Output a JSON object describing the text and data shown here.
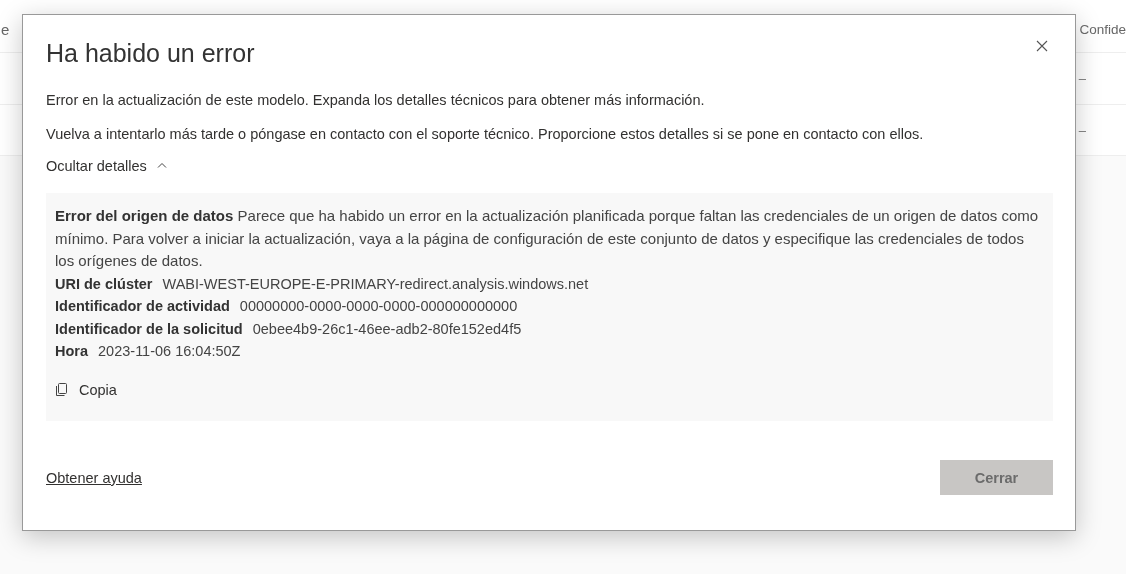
{
  "background": {
    "header": [
      "e",
      "Confide"
    ],
    "rows": [
      {
        "cell": "–"
      },
      {
        "cell": "–"
      }
    ]
  },
  "dialog": {
    "title": "Ha habido un error",
    "messages": [
      "Error en la actualización de este modelo. Expanda los detalles técnicos para obtener más información.",
      "Vuelva a intentarlo más tarde o póngase en contacto con el soporte técnico. Proporcione estos detalles si se pone en contacto con ellos."
    ],
    "details_toggle": {
      "label": "Ocultar detalles",
      "expanded": true
    },
    "details": {
      "summary": "**Error del origen de datos**  Parece que ha habido un error en la actualización planificada porque faltan las credenciales de un origen de datos como mínimo. Para volver a iniciar la actualización, vaya a la página de configuración de este conjunto de datos y especifique las credenciales de todos los orígenes de datos.",
      "fields": [
        {
          "label": "URI de clúster",
          "value": "WABI-WEST-EUROPE-E-PRIMARY-redirect.analysis.windows.net"
        },
        {
          "label": "Identificador de actividad",
          "value": "00000000-0000-0000-0000-000000000000"
        },
        {
          "label": "Identificador de la solicitud",
          "value": "0ebee4b9-26c1-46ee-adb2-80fe152ed4f5"
        },
        {
          "label": "Hora",
          "value": "2023-11-06 16:04:50Z"
        }
      ],
      "copy_button": "Copia"
    },
    "help_link": "Obtener ayuda",
    "close_button": {
      "label": "Cerrar",
      "disabled": true
    }
  }
}
